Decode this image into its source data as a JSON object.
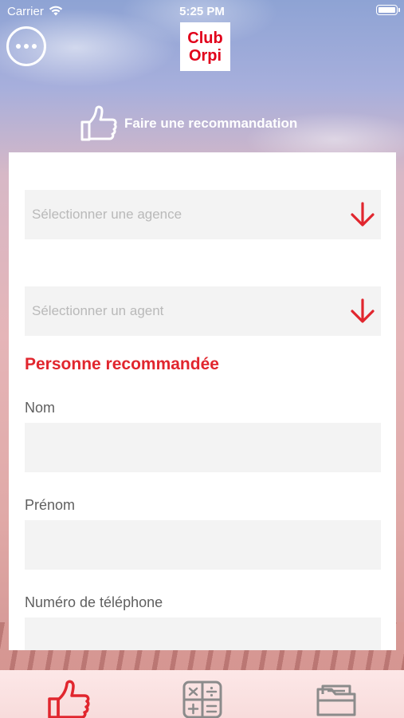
{
  "status_bar": {
    "carrier": "Carrier",
    "time": "5:25 PM"
  },
  "header": {
    "logo_line1": "Club",
    "logo_line2": "Orpi",
    "title": "Faire une recommandation"
  },
  "form": {
    "agency_select": {
      "placeholder": "Sélectionner une agence"
    },
    "agent_select": {
      "placeholder": "Sélectionner un agent"
    },
    "section_title": "Personne recommandée",
    "fields": [
      {
        "label": "Nom",
        "value": ""
      },
      {
        "label": "Prénom",
        "value": ""
      },
      {
        "label": "Numéro de téléphone",
        "value": ""
      }
    ]
  },
  "tab_bar": {
    "tabs": [
      {
        "icon": "thumbs-up-icon",
        "active": true
      },
      {
        "icon": "calculator-icon",
        "active": false
      },
      {
        "icon": "folder-icon",
        "active": false
      }
    ]
  },
  "colors": {
    "accent": "#e1262e",
    "logo_red": "#e1001a",
    "input_bg": "#f3f3f3",
    "placeholder": "#b9b9b9",
    "label": "#5f5f5f"
  }
}
